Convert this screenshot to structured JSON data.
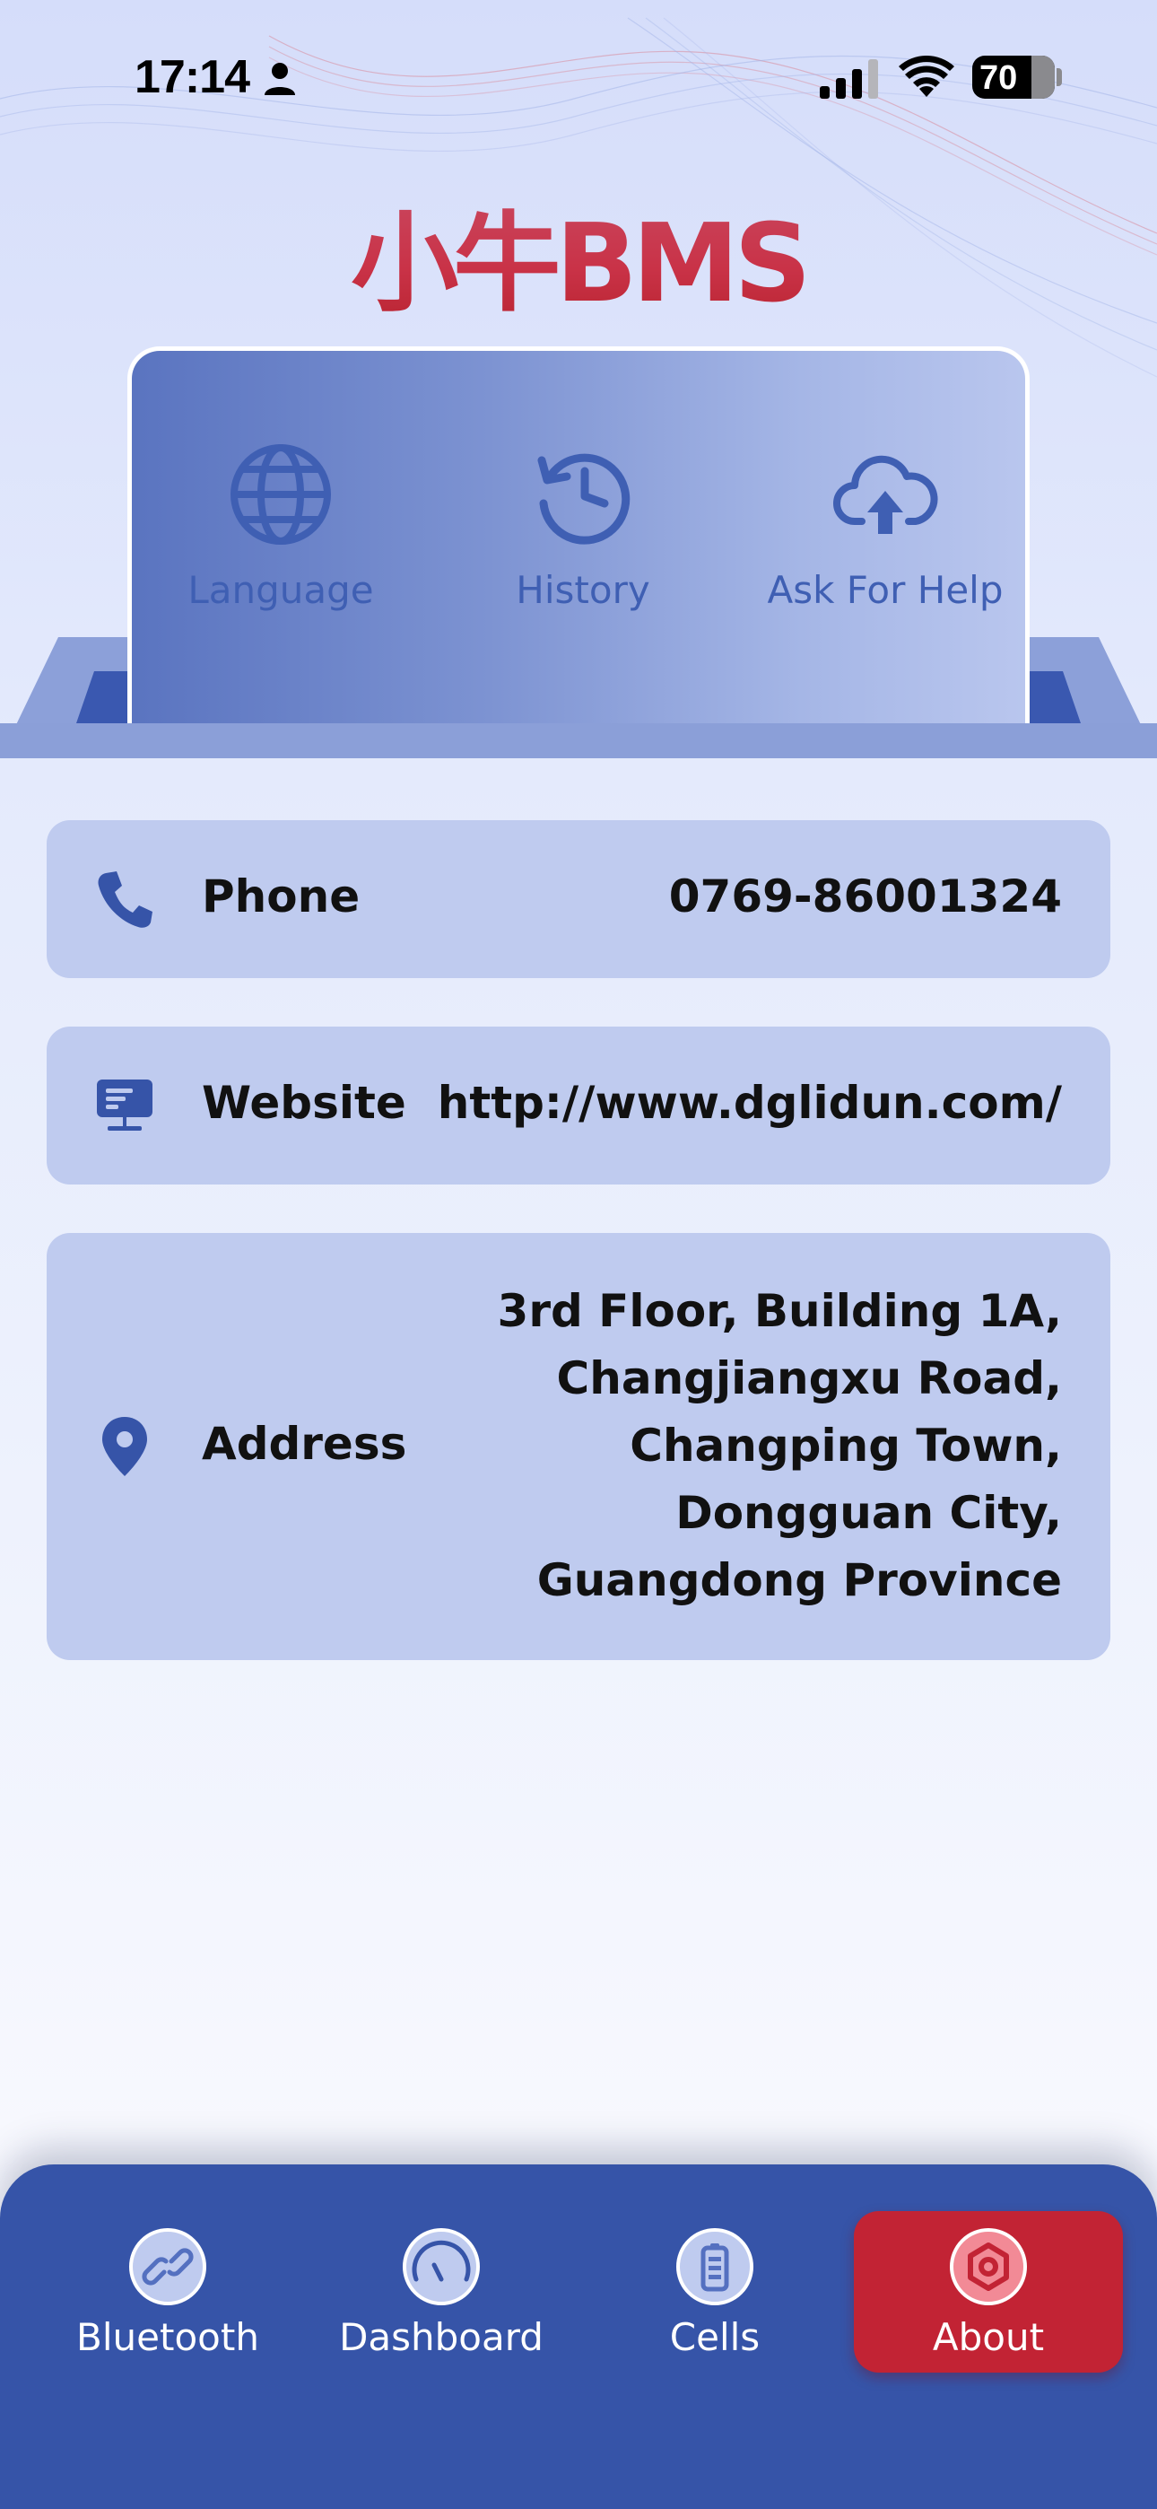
{
  "status_bar": {
    "time": "17:14",
    "battery": "70",
    "icons": [
      "person-icon",
      "signal-icon",
      "wifi-icon",
      "battery-icon"
    ]
  },
  "logo": {
    "text": "小牛BMS"
  },
  "quick_actions": [
    {
      "label": "Language",
      "icon": "globe-icon"
    },
    {
      "label": "History",
      "icon": "history-icon"
    },
    {
      "label": "Ask For Help",
      "icon": "cloud-upload-icon"
    }
  ],
  "info": {
    "phone": {
      "label": "Phone",
      "value": "0769-86001324",
      "icon": "phone-icon"
    },
    "website": {
      "label": "Website",
      "value": "http://www.dglidun.com/",
      "icon": "monitor-icon"
    },
    "address": {
      "label": "Address",
      "icon": "location-pin-icon",
      "lines": [
        "3rd Floor, Building 1A,",
        "Changjiangxu Road,",
        "Changping Town,",
        "Dongguan City,",
        "Guangdong Province"
      ]
    }
  },
  "nav": {
    "items": [
      {
        "label": "Bluetooth",
        "icon": "link-icon"
      },
      {
        "label": "Dashboard",
        "icon": "gauge-icon"
      },
      {
        "label": "Cells",
        "icon": "battery-cell-icon"
      },
      {
        "label": "About",
        "icon": "hexagon-nut-icon"
      }
    ],
    "active": "About"
  },
  "colors": {
    "accent": "#3654a8",
    "active_tab": "#c22334",
    "card": "#bfcbef",
    "logo_red": "#c93247"
  }
}
